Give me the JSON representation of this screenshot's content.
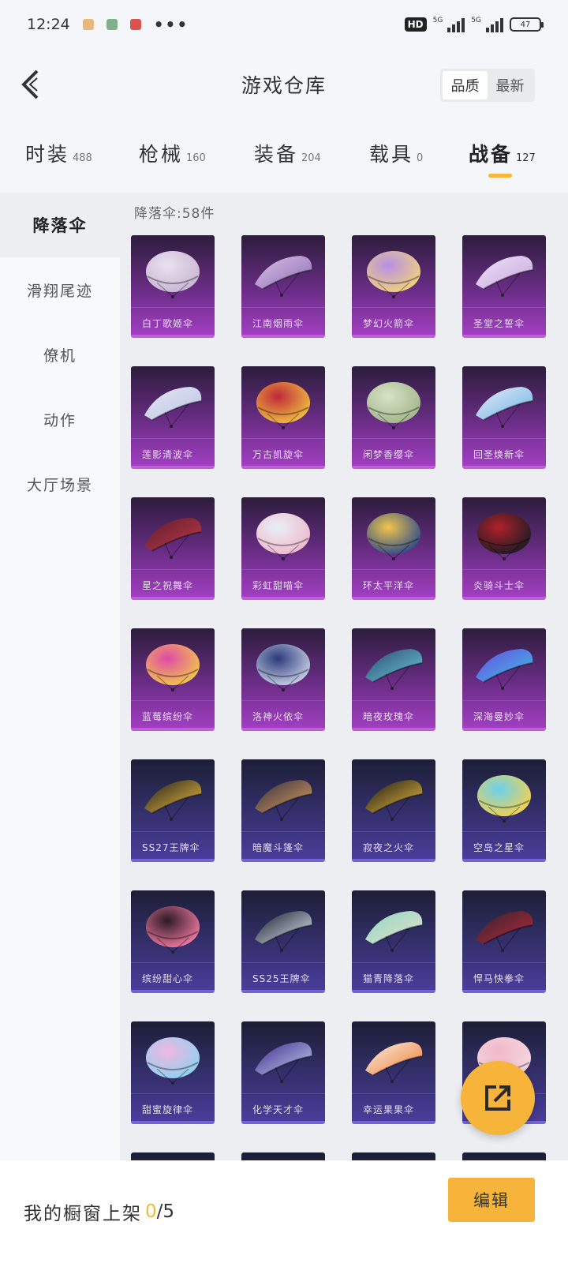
{
  "status_bar": {
    "time": "12:24",
    "hd_label": "HD",
    "net_label_1": "5G",
    "net_label_2": "5G",
    "battery_level": "47",
    "mini_icon_colors": [
      "#e8b87a",
      "#7fb08a",
      "#d9534f"
    ]
  },
  "header": {
    "title": "游戏仓库",
    "sort_options": [
      "品质",
      "最新"
    ],
    "active_sort": 0
  },
  "tabs": [
    {
      "label": "时装",
      "count": "488"
    },
    {
      "label": "枪械",
      "count": "160"
    },
    {
      "label": "装备",
      "count": "204"
    },
    {
      "label": "载具",
      "count": "0"
    },
    {
      "label": "战备",
      "count": "127",
      "active": true
    }
  ],
  "sidebar": {
    "items": [
      "降落伞",
      "滑翔尾迹",
      "僚机",
      "动作",
      "大厅场景"
    ],
    "active_index": 0
  },
  "section": {
    "title": "降落伞:58件"
  },
  "items": [
    {
      "name": "白丁歌姬伞",
      "theme": "purple",
      "colors": [
        "#e9e1ee",
        "#c8b5d3"
      ],
      "shape": "dome"
    },
    {
      "name": "江南烟雨伞",
      "theme": "purple",
      "colors": [
        "#d9c3e8",
        "#8e6bb3"
      ],
      "shape": "wing"
    },
    {
      "name": "梦幻火箭伞",
      "theme": "purple",
      "colors": [
        "#b58fe6",
        "#f2d27a"
      ],
      "shape": "dome"
    },
    {
      "name": "圣堂之誓伞",
      "theme": "purple",
      "colors": [
        "#ede3f6",
        "#c8a6e0"
      ],
      "shape": "wing"
    },
    {
      "name": "莲影清波伞",
      "theme": "purple",
      "colors": [
        "#e8e6f2",
        "#b9c4e6"
      ],
      "shape": "wing"
    },
    {
      "name": "万古凯旋伞",
      "theme": "purple",
      "colors": [
        "#c0283a",
        "#f0c040"
      ],
      "shape": "dome"
    },
    {
      "name": "闲梦香缨伞",
      "theme": "purple",
      "colors": [
        "#d8e3c6",
        "#a2b58b"
      ],
      "shape": "dome"
    },
    {
      "name": "回圣焕新伞",
      "theme": "purple",
      "colors": [
        "#e7ecf6",
        "#6cb2e6"
      ],
      "shape": "wing"
    },
    {
      "name": "星之祝舞伞",
      "theme": "purple",
      "colors": [
        "#5a1c2c",
        "#c23a4a"
      ],
      "shape": "wing"
    },
    {
      "name": "彩虹甜喵伞",
      "theme": "purple",
      "colors": [
        "#e8f0f6",
        "#f0b8cc"
      ],
      "shape": "dome"
    },
    {
      "name": "环太平洋伞",
      "theme": "purple",
      "colors": [
        "#f2c44a",
        "#2c4c8a"
      ],
      "shape": "dome"
    },
    {
      "name": "炎骑斗士伞",
      "theme": "purple",
      "colors": [
        "#b0202a",
        "#1c1c24"
      ],
      "shape": "dome"
    },
    {
      "name": "蓝莓缤纷伞",
      "theme": "purple",
      "colors": [
        "#e04aa8",
        "#f2c84a"
      ],
      "shape": "dome"
    },
    {
      "name": "洛神火依伞",
      "theme": "purple",
      "colors": [
        "#2a3a7a",
        "#c8d0e6"
      ],
      "shape": "dome"
    },
    {
      "name": "暗夜玫瑰伞",
      "theme": "purple",
      "colors": [
        "#2a4a6a",
        "#6ec8e0"
      ],
      "shape": "wing"
    },
    {
      "name": "深海曼妙伞",
      "theme": "purple",
      "colors": [
        "#6a4ae0",
        "#3ec0e6"
      ],
      "shape": "wing"
    },
    {
      "name": "SS27王牌伞",
      "theme": "blue",
      "colors": [
        "#1c1c1c",
        "#f0c040"
      ],
      "shape": "wing"
    },
    {
      "name": "暗魔斗篷伞",
      "theme": "blue",
      "colors": [
        "#2c2c40",
        "#e0a060"
      ],
      "shape": "wing"
    },
    {
      "name": "寂夜之火伞",
      "theme": "blue",
      "colors": [
        "#141414",
        "#f0c040"
      ],
      "shape": "wing"
    },
    {
      "name": "空岛之星伞",
      "theme": "blue",
      "colors": [
        "#6ad0f0",
        "#f6d24a"
      ],
      "shape": "dome"
    },
    {
      "name": "缤纷甜心伞",
      "theme": "blue",
      "colors": [
        "#2c1a24",
        "#f07aa0"
      ],
      "shape": "dome"
    },
    {
      "name": "SS25王牌伞",
      "theme": "blue",
      "colors": [
        "#101828",
        "#e6ecf6"
      ],
      "shape": "wing"
    },
    {
      "name": "猫青降落伞",
      "theme": "blue",
      "colors": [
        "#8ed8c0",
        "#e6e0d0"
      ],
      "shape": "wing"
    },
    {
      "name": "悍马快拳伞",
      "theme": "blue",
      "colors": [
        "#2a2430",
        "#c0283a"
      ],
      "shape": "wing"
    },
    {
      "name": "甜蜜旋律伞",
      "theme": "blue",
      "colors": [
        "#f0b8e0",
        "#8ed0f0"
      ],
      "shape": "dome"
    },
    {
      "name": "化学天才伞",
      "theme": "blue",
      "colors": [
        "#3a2a8a",
        "#c8d0f0"
      ],
      "shape": "wing"
    },
    {
      "name": "幸运果果伞",
      "theme": "blue",
      "colors": [
        "#f6f2e6",
        "#f07a30"
      ],
      "shape": "wing"
    },
    {
      "name": "",
      "theme": "blue",
      "colors": [
        "#f0b8c8",
        "#f6d8e0"
      ],
      "shape": "dome"
    },
    {
      "name": "",
      "theme": "blue",
      "colors": [
        "#d6e4f0",
        "#8ab0d0"
      ],
      "shape": "dome"
    },
    {
      "name": "",
      "theme": "blue",
      "colors": [
        "#e8e0d8",
        "#c0a890"
      ],
      "shape": "dome"
    },
    {
      "name": "",
      "theme": "blue",
      "colors": [
        "#e8c0a0",
        "#a06040"
      ],
      "shape": "dome"
    },
    {
      "name": "",
      "theme": "blue",
      "colors": [
        "#e8e8ee",
        "#b8b8c8"
      ],
      "shape": "dome"
    }
  ],
  "bottom_bar": {
    "label": "我的橱窗上架",
    "current": "0",
    "total": "/5",
    "edit_label": "编辑"
  },
  "icons": {
    "back": "back-arrow-icon",
    "share": "share-icon"
  }
}
